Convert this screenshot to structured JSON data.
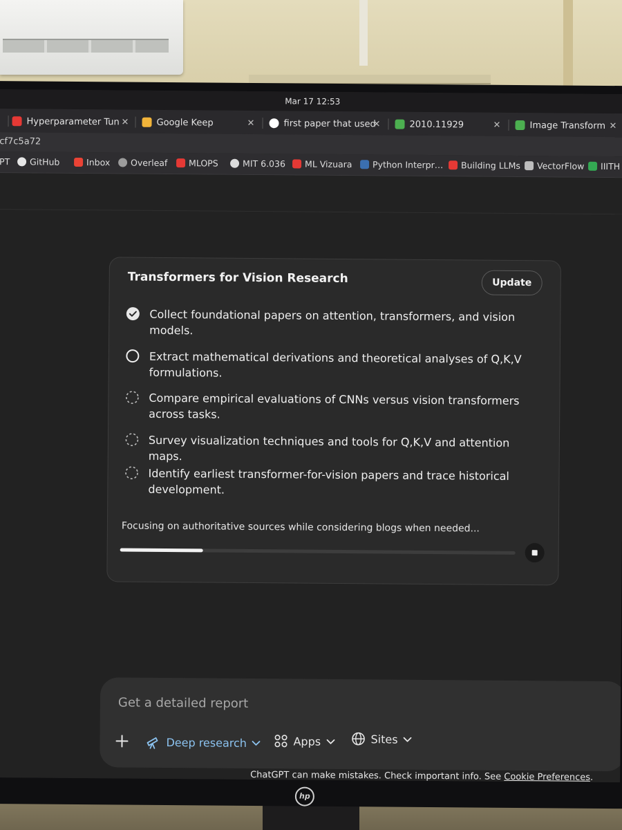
{
  "system": {
    "datetime": "Mar 17  12:53"
  },
  "tabs": [
    {
      "title": "Hyperparameter Tun",
      "color": "#e53935"
    },
    {
      "title": "Google Keep",
      "color": "#f2b43a"
    },
    {
      "title": "first paper that used",
      "color": "#ffffff"
    },
    {
      "title": "2010.11929",
      "color": "#4caf50"
    },
    {
      "title": "Image Transformer",
      "color": "#4caf50"
    }
  ],
  "url": {
    "text": "cf7c5a72"
  },
  "bookmarks": [
    {
      "label": "PT",
      "icon": "none"
    },
    {
      "label": "GitHub",
      "icon": "github-icon"
    },
    {
      "label": "Inbox",
      "icon": "gmail-icon"
    },
    {
      "label": "Overleaf",
      "icon": "overleaf-icon"
    },
    {
      "label": "MLOPS",
      "icon": "youtube-icon"
    },
    {
      "label": "MIT 6.036",
      "icon": "mit-icon"
    },
    {
      "label": "ML Vizuara",
      "icon": "youtube-icon"
    },
    {
      "label": "Python Interpr…",
      "icon": "python-icon"
    },
    {
      "label": "Building LLMs",
      "icon": "youtube-icon"
    },
    {
      "label": "VectorFlow",
      "icon": "vectorflow-icon"
    },
    {
      "label": "IIITH W",
      "icon": "drive-icon"
    }
  ],
  "research": {
    "title": "Transformers for Vision Research",
    "update_label": "Update",
    "steps": [
      {
        "text": "Collect foundational papers on attention, transformers, and vision models.",
        "state": "done"
      },
      {
        "text": "Extract mathematical derivations and theoretical analyses of Q,K,V formulations.",
        "state": "active"
      },
      {
        "text": "Compare empirical evaluations of CNNs versus vision transformers across tasks.",
        "state": "pending"
      },
      {
        "text": "Survey visualization techniques and tools for Q,K,V and attention maps.",
        "state": "pending"
      },
      {
        "text": "Identify earliest transformer-for-vision papers and trace historical development.",
        "state": "pending"
      }
    ],
    "status": "Focusing on authoritative sources while considering blogs when needed...",
    "progress": 0.21
  },
  "composer": {
    "placeholder": "Get a detailed report",
    "deep_research_label": "Deep research",
    "apps_label": "Apps",
    "sites_label": "Sites"
  },
  "disclaimer": {
    "text": "ChatGPT can make mistakes. Check important info. See",
    "link": "Cookie Preferences",
    "end": "."
  },
  "monitor": {
    "brand": "hp"
  },
  "colors": {
    "accent_blue": "#8cc3f0",
    "background": "#222222",
    "card": "#2a2a2a"
  }
}
